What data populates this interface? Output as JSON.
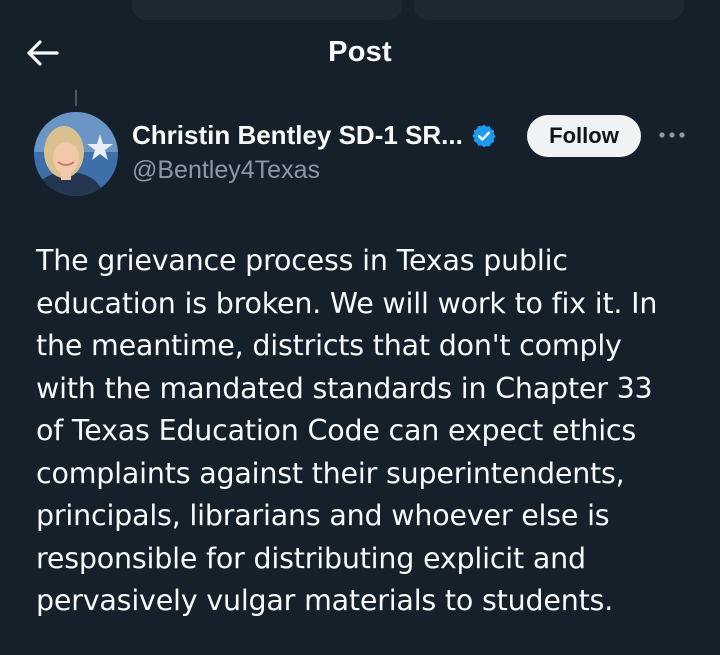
{
  "header": {
    "title": "Post",
    "back_icon": "arrow-left-icon"
  },
  "author": {
    "display_name": "Christin Bentley SD-1 SR...",
    "handle": "@Bentley4Texas",
    "verified_icon": "verified-badge-icon",
    "verified_color": "#1d9bf0",
    "follow_label": "Follow",
    "more_icon": "more-horizontal-icon"
  },
  "post": {
    "lines": [
      "The grievance process in Texas public",
      "education is broken. We will work to fix it. In",
      "the meantime, districts that don't comply",
      "with the mandated standards in Chapter 33",
      "of Texas Education Code can expect ethics",
      "complaints against their superintendents,",
      "principals, librarians and whoever else is",
      "responsible for distributing explicit and",
      "pervasively vulgar materials to students."
    ]
  },
  "colors": {
    "background": "#15202b",
    "text_primary": "#f7f9f9",
    "text_secondary": "#8b98a5",
    "follow_bg": "#eff3f4"
  }
}
